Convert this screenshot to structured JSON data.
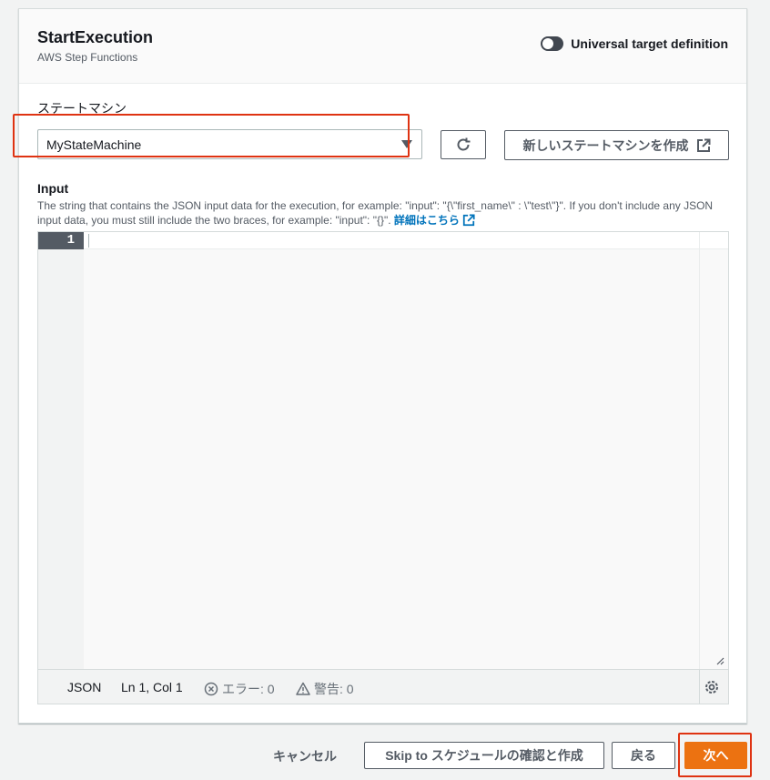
{
  "panel": {
    "title": "StartExecution",
    "subtitle": "AWS Step Functions",
    "toggle_label": "Universal target definition",
    "toggle_on": false
  },
  "state_machine": {
    "label": "ステートマシン",
    "selected": "MyStateMachine",
    "create_label": "新しいステートマシンを作成"
  },
  "input": {
    "label": "Input",
    "description": "The string that contains the JSON input data for the execution, for example: \"input\": \"{\\\"first_name\\\" : \\\"test\\\"}\". If you don't include any JSON input data, you must still include the two braces, for example: \"input\": \"{}\".",
    "link_text": "詳細はこちら"
  },
  "editor": {
    "line_number": "1",
    "content": "",
    "language": "JSON",
    "position": "Ln 1, Col 1",
    "errors_label": "エラー: 0",
    "warnings_label": "警告: 0"
  },
  "footer": {
    "cancel": "キャンセル",
    "skip": "Skip to スケジュールの確認と作成",
    "back": "戻る",
    "next": "次へ"
  },
  "colors": {
    "primary": "#ec7211",
    "highlight": "#df3312",
    "link": "#0073bb"
  },
  "icons": [
    "refresh-icon",
    "external-link-icon",
    "error-icon",
    "warning-icon",
    "settings-gear-icon",
    "resize-grip-icon",
    "dropdown-caret-icon"
  ]
}
